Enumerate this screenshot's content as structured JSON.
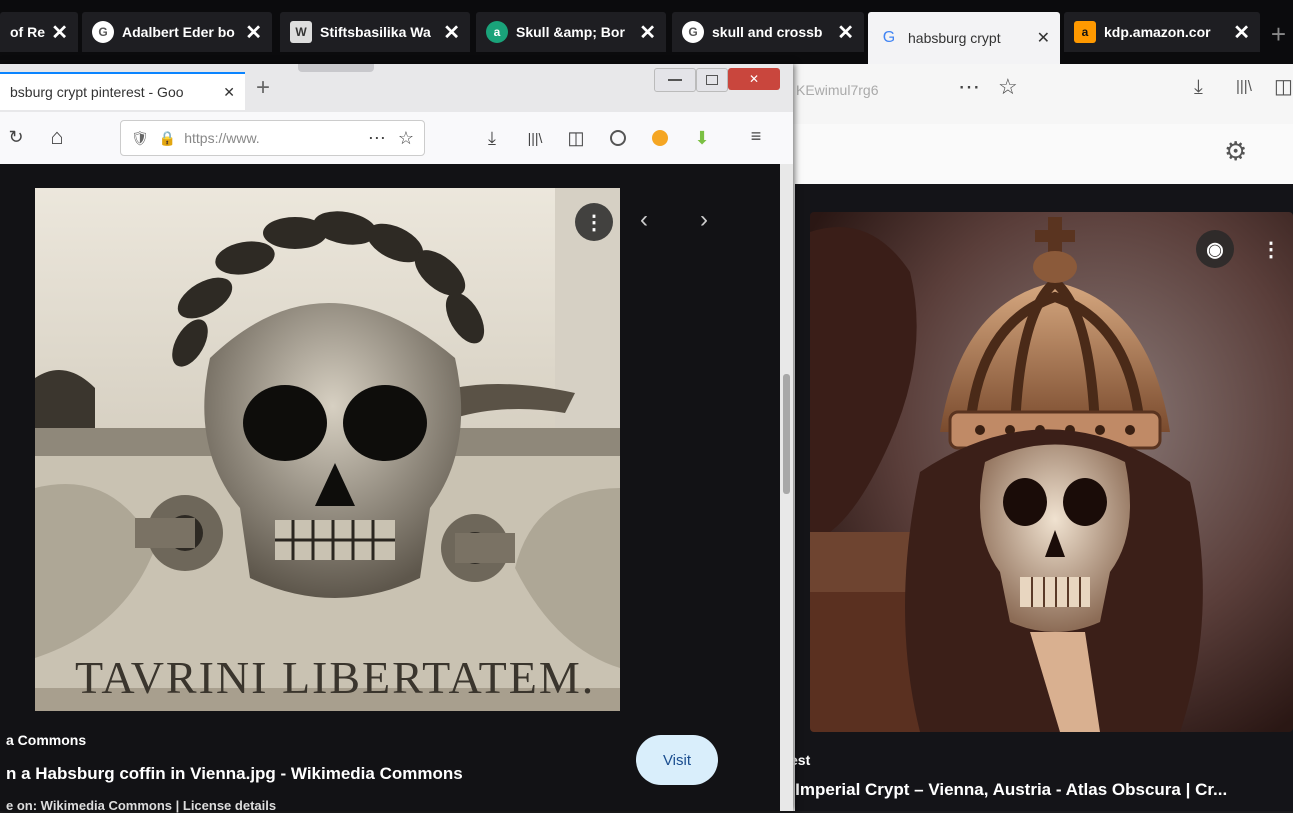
{
  "back_tabs": [
    {
      "label": "of Re",
      "icon": ""
    },
    {
      "label": "Adalbert Eder bo",
      "icon": "G"
    },
    {
      "label": "Stiftsbasilika Wa",
      "icon": "W"
    },
    {
      "label": "Skull &amp; Bor",
      "icon": "a"
    },
    {
      "label": "skull and crossb",
      "icon": "G"
    },
    {
      "label": "habsburg crypt",
      "icon": "G"
    },
    {
      "label": "kdp.amazon.cor",
      "icon": "a"
    }
  ],
  "back_window": {
    "url_fragment": "KEwimul7rg6",
    "caption_source": "est",
    "caption_title": "g Imperial Crypt – Vienna, Austria - Atlas Obscura | Cr..."
  },
  "front_window": {
    "tab_label": "bsburg crypt pinterest - Goo",
    "url": "https://www.",
    "caption_source": "a Commons",
    "caption_title": "n a Habsburg coffin in Vienna.jpg - Wikimedia Commons",
    "caption_sub": "e on: Wikimedia Commons | License details",
    "visit_label": "Visit"
  },
  "inscription": "TAVRINI  LIBERTATEM.",
  "icons": {
    "close": "✕",
    "plus": "+",
    "home": "⌂",
    "reload": "↻",
    "menu": "⋯",
    "star": "☆",
    "download": "⤓",
    "library": "|||\\",
    "sidebar": "◫",
    "more_vert": "⋮",
    "prev": "‹",
    "next": "›",
    "lens": "◉",
    "gear": "⚙"
  },
  "colors": {
    "accent": "#0a84ff",
    "visit_bg": "#d9eefb"
  }
}
